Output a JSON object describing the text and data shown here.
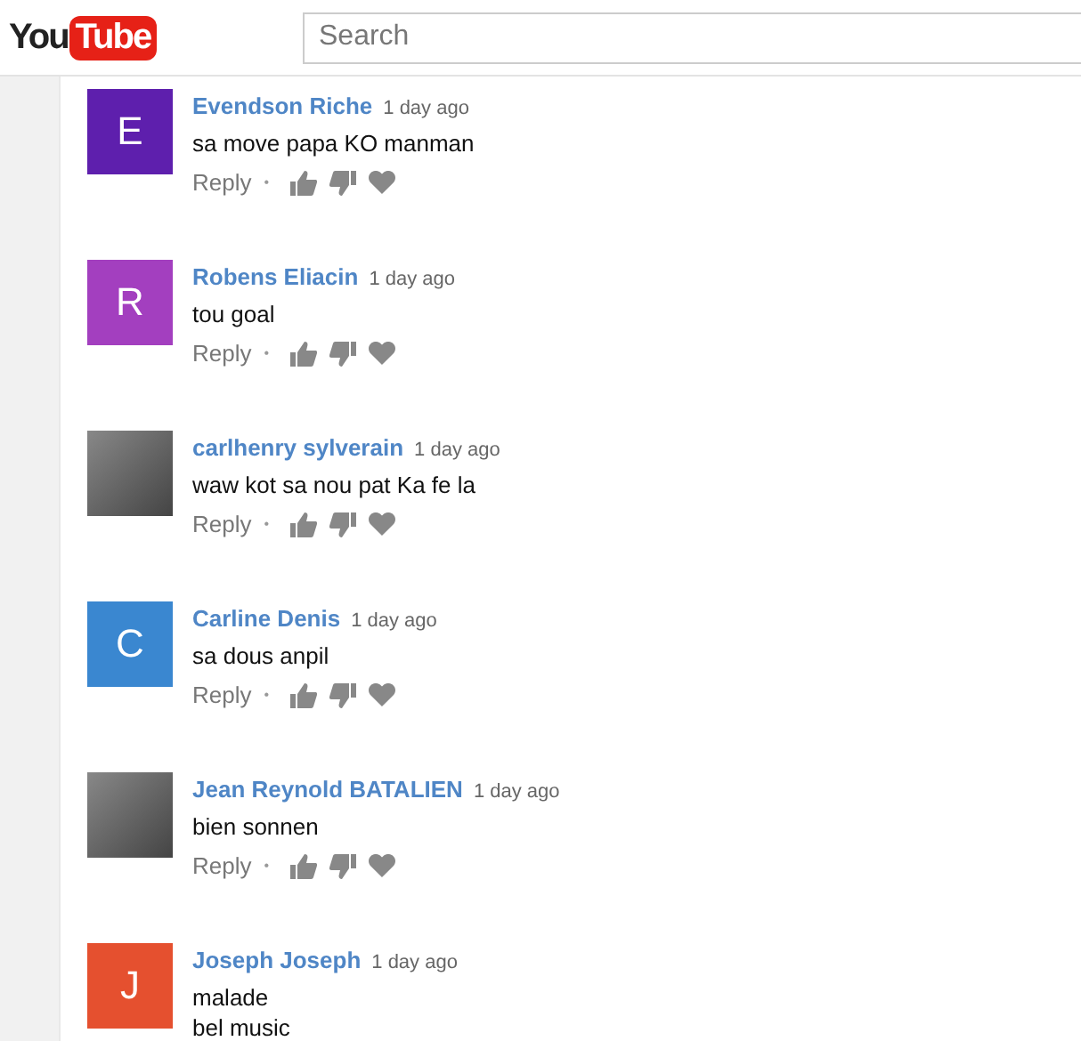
{
  "header": {
    "logo": {
      "left": "You",
      "right": "Tube"
    },
    "search": {
      "placeholder": "Search"
    }
  },
  "comments": [
    {
      "author": "Evendson Riche",
      "time": "1 day ago",
      "text": "sa move papa KO manman",
      "avatar": {
        "kind": "letter",
        "letter": "E",
        "color": "#5e1fad"
      },
      "reply": "Reply",
      "separator": "•"
    },
    {
      "author": "Robens Eliacin",
      "time": "1 day ago",
      "text": "tou goal",
      "avatar": {
        "kind": "letter",
        "letter": "R",
        "color": "#a33fbf"
      },
      "reply": "Reply",
      "separator": "•"
    },
    {
      "author": "carlhenry sylverain",
      "time": "1 day ago",
      "text": "waw kot sa nou pat Ka fe la",
      "avatar": {
        "kind": "photo"
      },
      "reply": "Reply",
      "separator": "•"
    },
    {
      "author": "Carline Denis",
      "time": "1 day ago",
      "text": "sa dous anpil",
      "avatar": {
        "kind": "letter",
        "letter": "C",
        "color": "#3a87d0"
      },
      "reply": "Reply",
      "separator": "•"
    },
    {
      "author": "Jean Reynold BATALIEN",
      "time": "1 day ago",
      "text": "bien sonnen",
      "avatar": {
        "kind": "photo"
      },
      "reply": "Reply",
      "separator": "•"
    },
    {
      "author": "Joseph Joseph",
      "time": "1 day ago",
      "text": "malade\nbel music",
      "avatar": {
        "kind": "letter",
        "letter": "J",
        "color": "#e5502f"
      }
    }
  ]
}
